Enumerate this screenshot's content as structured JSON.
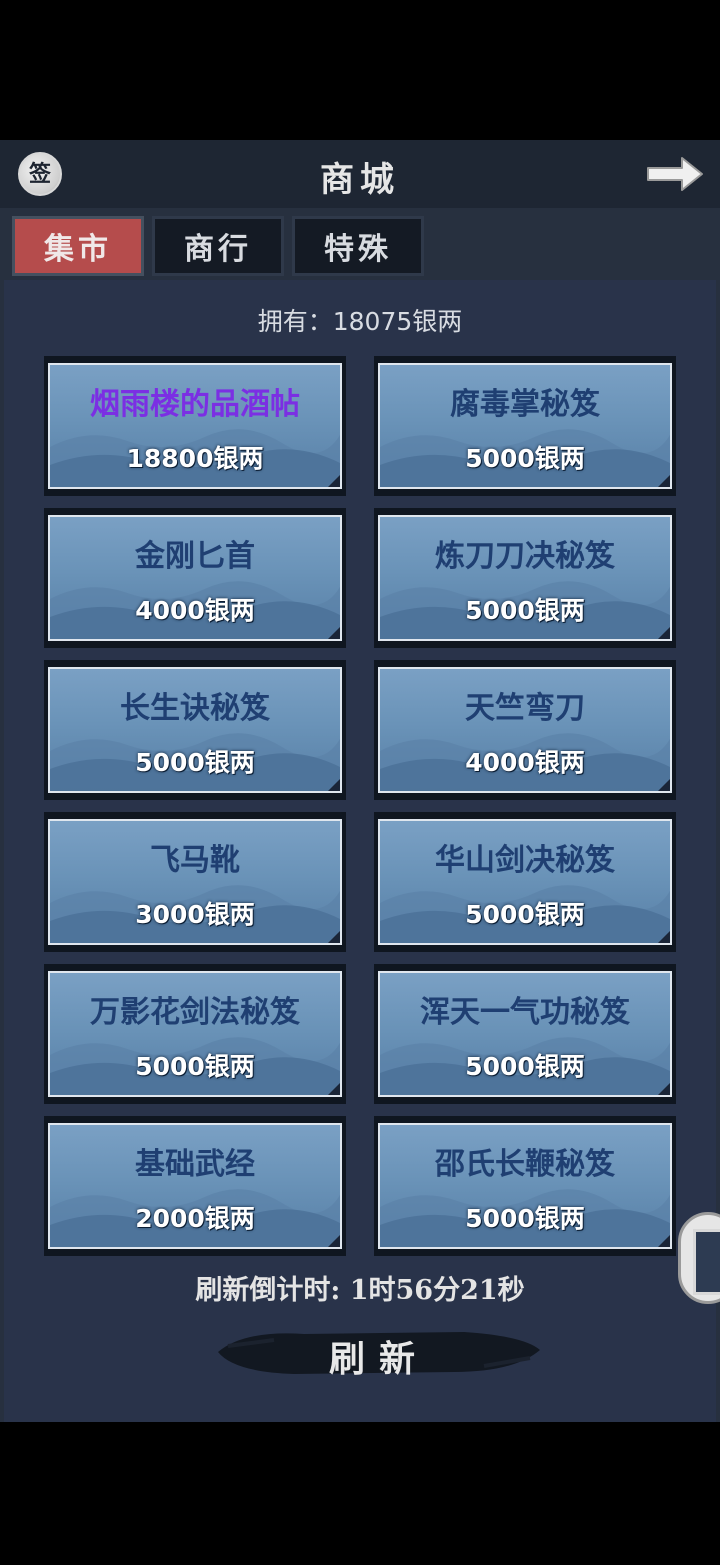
{
  "header": {
    "title": "商城",
    "sign_label": "签"
  },
  "tabs": [
    {
      "label": "集市",
      "active": true
    },
    {
      "label": "商行",
      "active": false
    },
    {
      "label": "特殊",
      "active": false
    }
  ],
  "owned": {
    "text": "拥有：18075银两"
  },
  "items": [
    {
      "name": "烟雨楼的品酒帖",
      "price": "18800银两",
      "rare": true
    },
    {
      "name": "腐毒掌秘笈",
      "price": "5000银两",
      "rare": false
    },
    {
      "name": "金刚匕首",
      "price": "4000银两",
      "rare": false
    },
    {
      "name": "炼刀刀决秘笈",
      "price": "5000银两",
      "rare": false
    },
    {
      "name": "长生诀秘笈",
      "price": "5000银两",
      "rare": false
    },
    {
      "name": "天竺弯刀",
      "price": "4000银两",
      "rare": false
    },
    {
      "name": "飞马靴",
      "price": "3000银两",
      "rare": false
    },
    {
      "name": "华山剑决秘笈",
      "price": "5000银两",
      "rare": false
    },
    {
      "name": "万影花剑法秘笈",
      "price": "5000银两",
      "rare": false
    },
    {
      "name": "浑天一气功秘笈",
      "price": "5000银两",
      "rare": false
    },
    {
      "name": "基础武经",
      "price": "2000银两",
      "rare": false
    },
    {
      "name": "邵氏长鞭秘笈",
      "price": "5000银两",
      "rare": false
    }
  ],
  "countdown": {
    "text": "刷新倒计时: 1时56分21秒"
  },
  "refresh": {
    "label": "刷新"
  },
  "icons": {
    "back": "arrow-right-icon",
    "sign": "sign-in-icon",
    "side": "scroll-icon"
  }
}
